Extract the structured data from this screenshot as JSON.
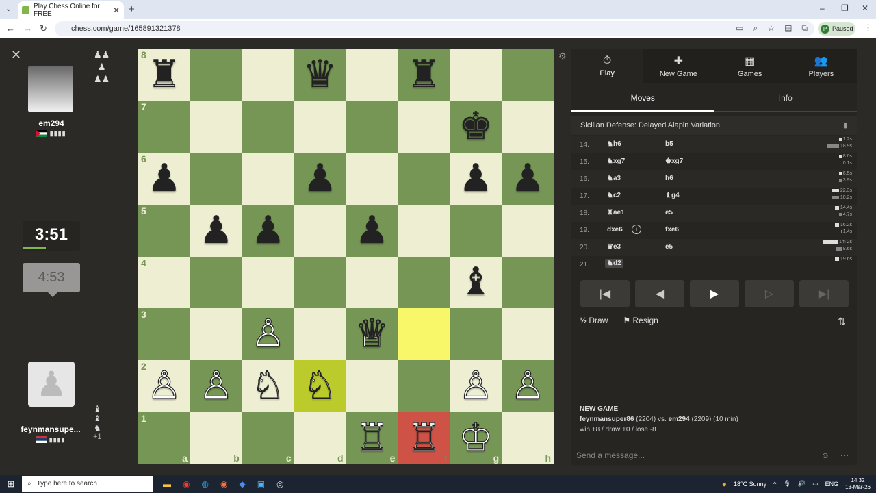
{
  "browser": {
    "tab_title": "Play Chess Online for FREE",
    "url": "chess.com/game/165891321378",
    "paused_label": "Paused",
    "profile_initial": "P"
  },
  "top_player": {
    "name": "em294",
    "clock": "3:51",
    "flag": "Palestine"
  },
  "bottom_player": {
    "name": "feynmansupe...",
    "clock": "4:53",
    "flag": "Serbia",
    "material": "+1"
  },
  "board": {
    "ranks": [
      "8",
      "7",
      "6",
      "5",
      "4",
      "3",
      "2",
      "1"
    ],
    "files": [
      "a",
      "b",
      "c",
      "d",
      "e",
      "f",
      "g",
      "h"
    ],
    "pieces": [
      [
        "♜",
        "",
        "",
        "♛",
        "",
        "♜",
        "",
        ""
      ],
      [
        "",
        "",
        "",
        "",
        "",
        "",
        "♚",
        ""
      ],
      [
        "♟",
        "",
        "",
        "♟",
        "",
        "",
        "♟",
        "♟"
      ],
      [
        "",
        "♟",
        "♟",
        "",
        "♟",
        "",
        "",
        ""
      ],
      [
        "",
        "",
        "",
        "",
        "",
        "",
        "♝",
        ""
      ],
      [
        "",
        "",
        "♙",
        "",
        "♕",
        "",
        "",
        ""
      ],
      [
        "♙",
        "♙",
        "♘",
        "♘",
        "",
        "",
        "♙",
        "♙"
      ],
      [
        "",
        "",
        "",
        "",
        "♖",
        "♖",
        "♔",
        ""
      ]
    ],
    "colors": [
      [
        "b",
        "",
        "",
        "b",
        "",
        "b",
        "",
        ""
      ],
      [
        "",
        "",
        "",
        "",
        "",
        "",
        "b",
        ""
      ],
      [
        "b",
        "",
        "",
        "b",
        "",
        "",
        "b",
        "b"
      ],
      [
        "",
        "b",
        "b",
        "",
        "b",
        "",
        "",
        ""
      ],
      [
        "",
        "",
        "",
        "",
        "",
        "",
        "b",
        ""
      ],
      [
        "",
        "",
        "w",
        "",
        "w",
        "",
        "",
        ""
      ],
      [
        "w",
        "w",
        "w",
        "w",
        "",
        "",
        "w",
        "w"
      ],
      [
        "",
        "",
        "",
        "",
        "w",
        "w",
        "w",
        ""
      ]
    ]
  },
  "panel": {
    "tabs": [
      {
        "label": "Play",
        "icon": "⏱"
      },
      {
        "label": "New Game",
        "icon": "✚"
      },
      {
        "label": "Games",
        "icon": "▦"
      },
      {
        "label": "Players",
        "icon": "👥"
      }
    ],
    "subtabs": [
      "Moves",
      "Info"
    ],
    "opening": "Sicilian Defense: Delayed Alapin Variation",
    "moves": [
      {
        "n": "14.",
        "w": "♞h6",
        "b": "b5",
        "tw": "1.2s",
        "tb": "18.9s"
      },
      {
        "n": "15.",
        "w": "♞xg7",
        "b": "♚xg7",
        "tw": "8.0s",
        "tb": "0.1s"
      },
      {
        "n": "16.",
        "w": "♞a3",
        "b": "h6",
        "tw": "6.5s",
        "tb": "3.9s"
      },
      {
        "n": "17.",
        "w": "♞c2",
        "b": "♝g4",
        "tw": "22.3s",
        "tb": "10.2s"
      },
      {
        "n": "18.",
        "w": "♜ae1",
        "b": "e5",
        "tw": "14.4s",
        "tb": "4.7s"
      },
      {
        "n": "19.",
        "w": "dxe6",
        "b": "fxe6",
        "tw": "16.2s",
        "tb": "1.4s"
      },
      {
        "n": "20.",
        "w": "♛e3",
        "b": "e5",
        "tw": "1m 2s",
        "tb": "8.6s"
      },
      {
        "n": "21.",
        "w": "♞d2",
        "b": "",
        "tw": "19.6s",
        "tb": ""
      }
    ],
    "draw_label": "Draw",
    "resign_label": "Resign",
    "new_game_title": "NEW GAME",
    "players_line_white": "feynmansuper86",
    "players_line_white_rating": "(2204) vs.",
    "players_line_black": "em294",
    "players_line_black_rating": "(2209) (10 min)",
    "record": "win +8 / draw +0 / lose -8",
    "message_placeholder": "Send a message..."
  },
  "taskbar": {
    "search_placeholder": "Type here to search",
    "weather": "18°C  Sunny",
    "lang": "ENG",
    "time": "14:32",
    "date": "13-Mar-26"
  }
}
